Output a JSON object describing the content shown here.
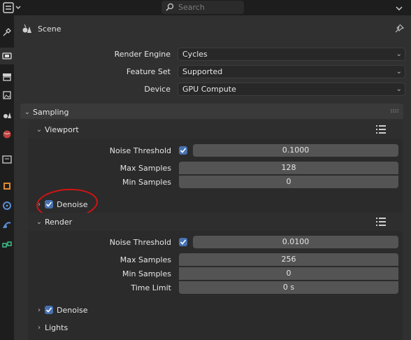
{
  "topbar": {
    "search_placeholder": "Search"
  },
  "header": {
    "title": "Scene"
  },
  "render_settings": {
    "render_engine": {
      "label": "Render Engine",
      "value": "Cycles"
    },
    "feature_set": {
      "label": "Feature Set",
      "value": "Supported"
    },
    "device": {
      "label": "Device",
      "value": "GPU Compute"
    }
  },
  "sampling": {
    "title": "Sampling",
    "viewport": {
      "title": "Viewport",
      "noise_threshold_label": "Noise Threshold",
      "noise_threshold_value": "0.1000",
      "max_samples_label": "Max Samples",
      "max_samples_value": "128",
      "min_samples_label": "Min Samples",
      "min_samples_value": "0",
      "denoise_label": "Denoise"
    },
    "render": {
      "title": "Render",
      "noise_threshold_label": "Noise Threshold",
      "noise_threshold_value": "0.0100",
      "max_samples_label": "Max Samples",
      "max_samples_value": "256",
      "min_samples_label": "Min Samples",
      "min_samples_value": "0",
      "time_limit_label": "Time Limit",
      "time_limit_value": "0 s",
      "denoise_label": "Denoise"
    },
    "lights_label": "Lights"
  },
  "colors": {
    "accent": "#4772b3",
    "annotation": "#d11414"
  },
  "icons": {
    "search": "search-icon",
    "pin": "pin-icon",
    "scene": "scene-icon"
  }
}
